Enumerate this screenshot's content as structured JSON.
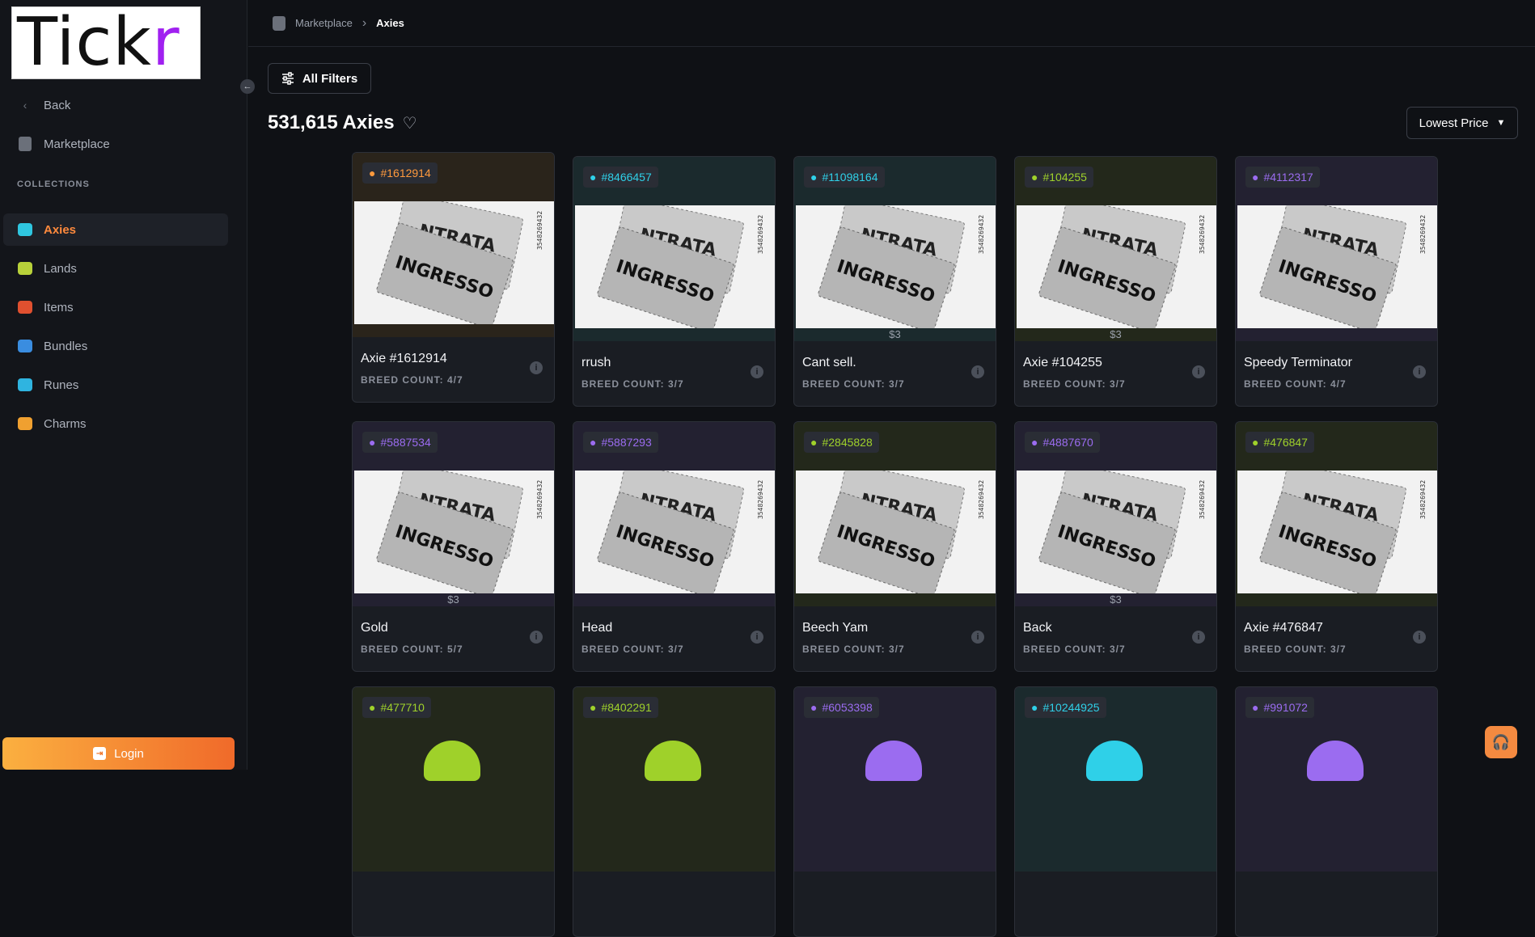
{
  "logo": {
    "text_main": "Tick",
    "text_accent": "r"
  },
  "sidebar": {
    "back_label": "Back",
    "marketplace_label": "Marketplace",
    "collections_label": "COLLECTIONS",
    "items": [
      {
        "label": "Axies",
        "icon": "axie-icon",
        "color": "#2fc6e0"
      },
      {
        "label": "Lands",
        "icon": "land-icon",
        "color": "#b8d13a"
      },
      {
        "label": "Items",
        "icon": "item-icon",
        "color": "#e0502f"
      },
      {
        "label": "Bundles",
        "icon": "bundle-icon",
        "color": "#3a8de0"
      },
      {
        "label": "Runes",
        "icon": "rune-icon",
        "color": "#2fb4e0"
      },
      {
        "label": "Charms",
        "icon": "charm-icon",
        "color": "#f0a030"
      }
    ],
    "login_label": "Login"
  },
  "breadcrumb": {
    "root": "Marketplace",
    "separator": "›",
    "current": "Axies"
  },
  "toolbar": {
    "filters_label": "All Filters",
    "sort_label": "Lowest Price"
  },
  "results": {
    "count_title": "531,615 Axies"
  },
  "class_colors": {
    "beast": "#ff9a3d",
    "aquatic": "#2fd0e8",
    "plant": "#9fd12a",
    "bug": "#9b6cf0"
  },
  "cards": [
    {
      "id": "#1612914",
      "class": "beast",
      "name": "Axie #1612914",
      "breed": "BREED COUNT: 4/7",
      "price": ""
    },
    {
      "id": "#8466457",
      "class": "aquatic",
      "name": "rrush",
      "breed": "BREED COUNT: 3/7",
      "price": ""
    },
    {
      "id": "#11098164",
      "class": "aquatic",
      "name": "Cant sell.",
      "breed": "BREED COUNT: 3/7",
      "price": "$3"
    },
    {
      "id": "#104255",
      "class": "plant",
      "name": "Axie #104255",
      "breed": "BREED COUNT: 3/7",
      "price": "$3"
    },
    {
      "id": "#4112317",
      "class": "bug",
      "name": "Speedy Terminator",
      "breed": "BREED COUNT: 4/7",
      "price": ""
    },
    {
      "id": "#5887534",
      "class": "bug",
      "name": "Gold",
      "breed": "BREED COUNT: 5/7",
      "price": "$3"
    },
    {
      "id": "#5887293",
      "class": "bug",
      "name": "Head",
      "breed": "BREED COUNT: 3/7",
      "price": ""
    },
    {
      "id": "#2845828",
      "class": "plant",
      "name": "Beech Yam",
      "breed": "BREED COUNT: 3/7",
      "price": ""
    },
    {
      "id": "#4887670",
      "class": "bug",
      "name": "Back",
      "breed": "BREED COUNT: 3/7",
      "price": "$3"
    },
    {
      "id": "#476847",
      "class": "plant",
      "name": "Axie #476847",
      "breed": "BREED COUNT: 3/7",
      "price": ""
    },
    {
      "id": "#477710",
      "class": "plant",
      "name": "",
      "breed": "",
      "price": ""
    },
    {
      "id": "#8402291",
      "class": "plant",
      "name": "",
      "breed": "",
      "price": ""
    },
    {
      "id": "#6053398",
      "class": "bug",
      "name": "",
      "breed": "",
      "price": ""
    },
    {
      "id": "#10244925",
      "class": "aquatic",
      "name": "",
      "breed": "",
      "price": ""
    },
    {
      "id": "#991072",
      "class": "bug",
      "name": "",
      "breed": "",
      "price": ""
    }
  ],
  "ticket": {
    "top_text": "NTRATA",
    "main_text": "INGRESSO",
    "serial": "3548269432"
  }
}
